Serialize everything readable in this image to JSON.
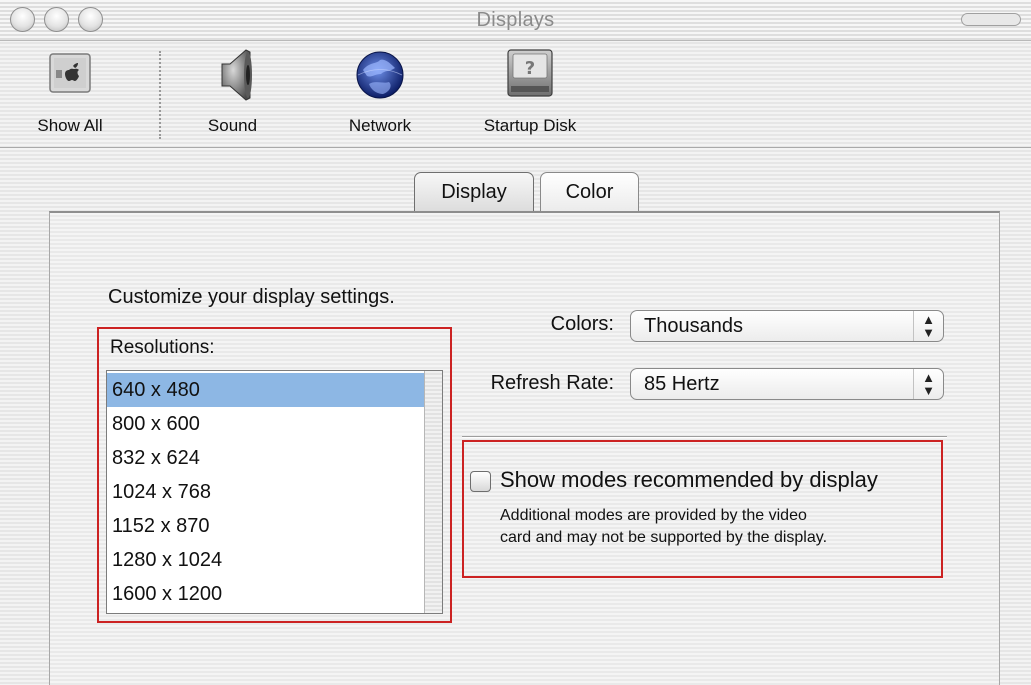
{
  "window": {
    "title": "Displays"
  },
  "toolbar": {
    "items": [
      {
        "label": "Show All",
        "icon": "apple-show-all-icon"
      },
      {
        "label": "Sound",
        "icon": "speaker-icon"
      },
      {
        "label": "Network",
        "icon": "globe-icon"
      },
      {
        "label": "Startup Disk",
        "icon": "hard-disk-icon"
      }
    ]
  },
  "tabs": [
    {
      "label": "Display",
      "active": true
    },
    {
      "label": "Color",
      "active": false
    }
  ],
  "panel": {
    "heading": "Customize your display settings.",
    "resolutions": {
      "label": "Resolutions:",
      "selected": "640 x 480",
      "items": [
        "640 x 480",
        "800 x 600",
        "832 x 624",
        "1024 x 768",
        "1152 x 870",
        "1280 x 1024",
        "1600 x 1200"
      ]
    },
    "colors": {
      "label": "Colors:",
      "value": "Thousands"
    },
    "refresh_rate": {
      "label": "Refresh Rate:",
      "value": "85 Hertz"
    },
    "show_modes": {
      "label": "Show modes recommended by display",
      "checked": false,
      "note_line1": "Additional modes are provided by the video",
      "note_line2": "card and may not be supported by the display."
    }
  },
  "colors": {
    "selection": "#8db7e4",
    "annotation": "#cc2222"
  }
}
